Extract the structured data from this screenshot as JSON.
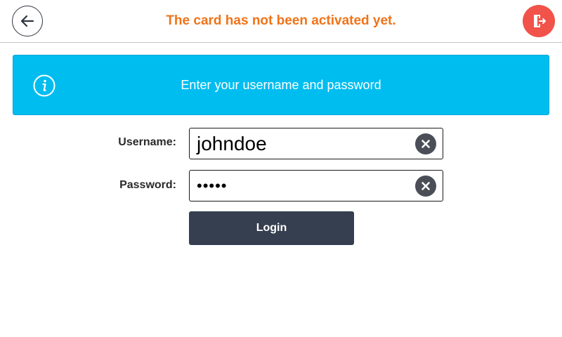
{
  "header": {
    "title": "The card has not been activated yet.",
    "title_color": "#f07318",
    "back_icon": "arrow-left-icon",
    "exit_icon": "exit-door-icon",
    "exit_color": "#f15249"
  },
  "banner": {
    "icon": "info-icon",
    "text": "Enter your username and password",
    "color": "#00bdf0"
  },
  "form": {
    "username": {
      "label": "Username:",
      "value": "johndoe",
      "clear_icon": "clear-x-icon"
    },
    "password": {
      "label": "Password:",
      "value": "•••••",
      "clear_icon": "clear-x-icon"
    },
    "login_label": "Login"
  }
}
